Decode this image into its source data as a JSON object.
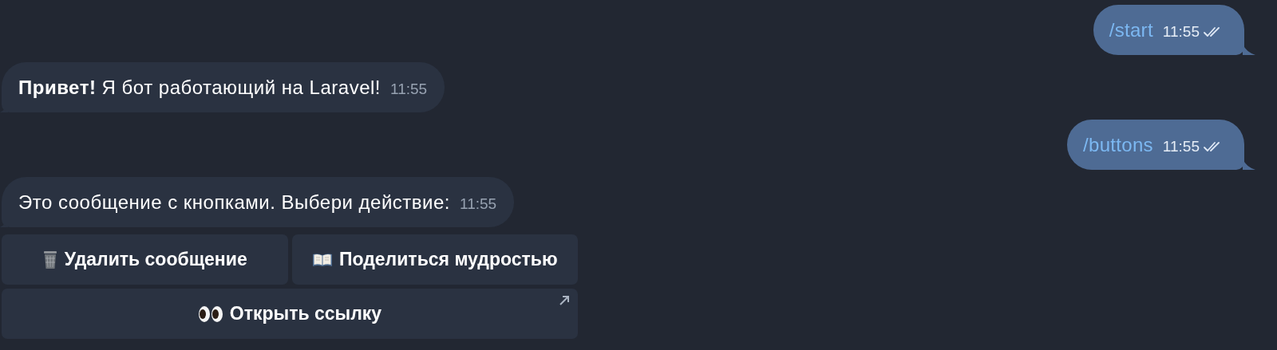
{
  "messages": [
    {
      "kind": "outgoing",
      "text": "/start",
      "time": "11:55",
      "read": true
    },
    {
      "kind": "incoming",
      "text": "**Привет!** Я бот работающий на Laravel!",
      "time": "11:55"
    },
    {
      "kind": "outgoing",
      "text": "/buttons",
      "time": "11:55",
      "read": true
    },
    {
      "kind": "incoming",
      "text": "Это сообщение с кнопками. Выбери действие:",
      "time": "11:55",
      "keyboard": [
        [
          {
            "kind": "callback",
            "label": "Удалить сообщение"
          },
          {
            "kind": "callback",
            "label": "Поделиться мудростью"
          }
        ],
        [
          {
            "kind": "url",
            "label": "Открыть ссылку"
          }
        ]
      ]
    }
  ]
}
